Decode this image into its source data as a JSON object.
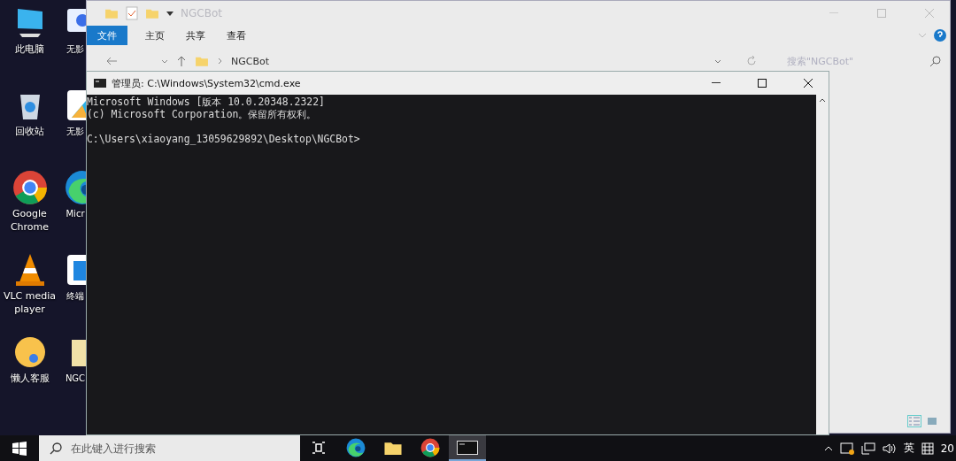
{
  "desktop_icons": [
    {
      "label": "此电脑",
      "kind": "computer"
    },
    {
      "label": "无影",
      "kind": "remote"
    },
    {
      "label": "回收站",
      "kind": "bin"
    },
    {
      "label": "无影",
      "kind": "tool"
    },
    {
      "label": "Google Chrome",
      "kind": "chrome"
    },
    {
      "label": "Micr",
      "kind": "edge"
    },
    {
      "label": "VLC media player",
      "kind": "vlc"
    },
    {
      "label": "终端",
      "kind": "doc"
    },
    {
      "label": "懒人客服",
      "kind": "emoji"
    },
    {
      "label": "NGC",
      "kind": "folder"
    }
  ],
  "explorer": {
    "title": "NGCBot",
    "tabs": [
      {
        "label": "文件",
        "selected": true
      },
      {
        "label": "主页",
        "selected": false
      },
      {
        "label": "共享",
        "selected": false
      },
      {
        "label": "查看",
        "selected": false
      }
    ],
    "path": "NGCBot",
    "search": {
      "placeholder": "搜索\"NGCBot\""
    }
  },
  "cmd": {
    "title": "管理员: C:\\Windows\\System32\\cmd.exe",
    "banner": [
      "Microsoft Windows [版本 10.0.20348.2322]",
      "(c) Microsoft Corporation。保留所有权利。"
    ],
    "prompt": "C:\\Users\\xiaoyang_13059629892\\Desktop\\NGCBot>"
  },
  "taskbar": {
    "search": {
      "placeholder": "在此键入进行搜索"
    },
    "apps": [
      {
        "kind": "taskview",
        "active": false
      },
      {
        "kind": "edge",
        "active": false
      },
      {
        "kind": "folder",
        "active": false
      },
      {
        "kind": "chrome",
        "active": false
      },
      {
        "kind": "cmd",
        "active": true
      }
    ],
    "ime": "英",
    "clock": "20"
  }
}
